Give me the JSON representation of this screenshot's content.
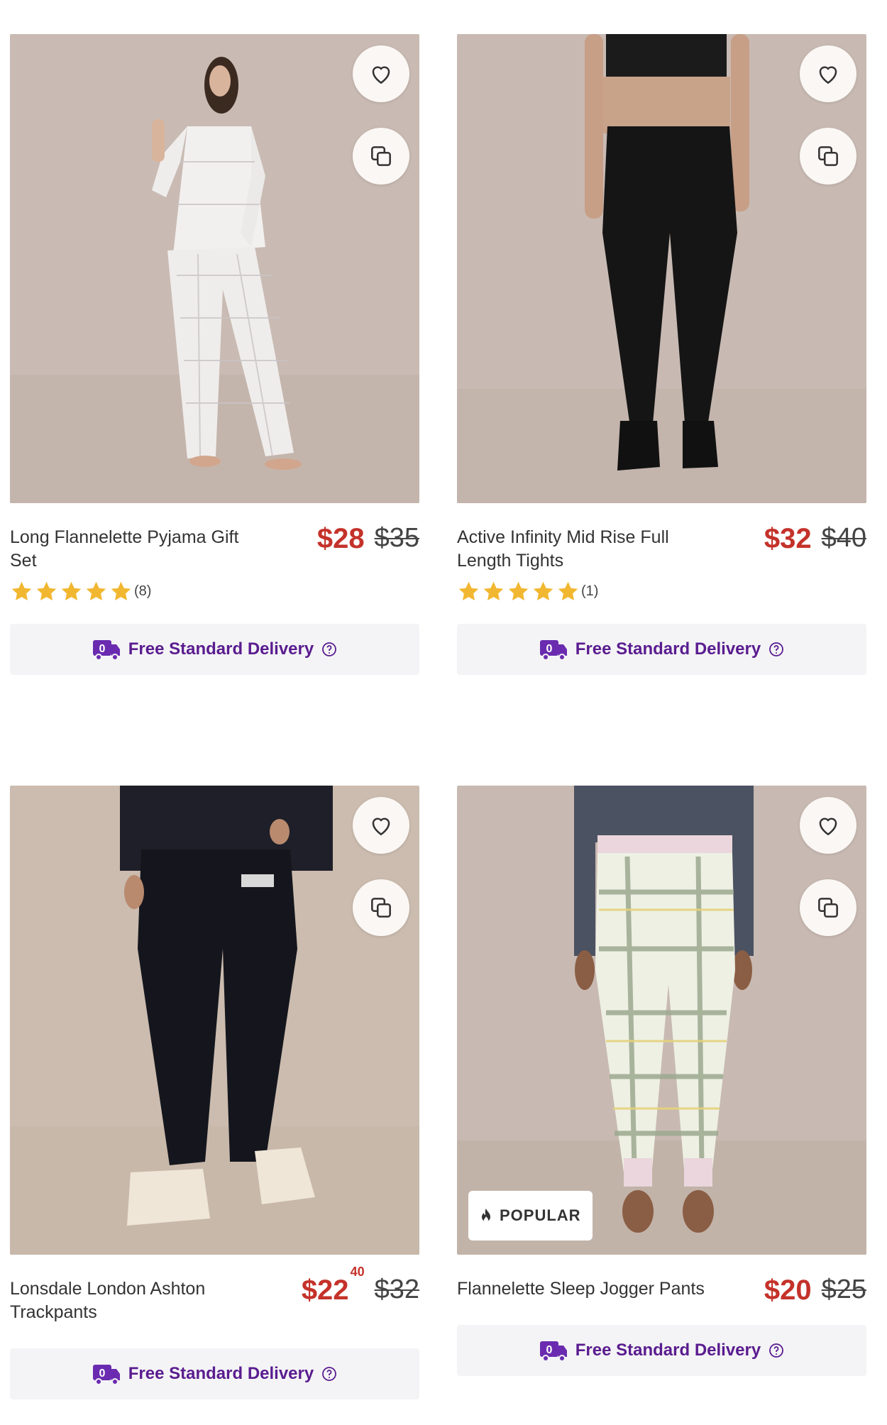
{
  "products": [
    {
      "name": "Long Flannelette Pyjama Gift Set",
      "price_now": "$28",
      "price_now_cents": "",
      "price_was": "$35",
      "rating": 5,
      "review_count": "(8)",
      "delivery_label": "Free Standard Delivery",
      "badge": ""
    },
    {
      "name": "Active Infinity Mid Rise Full Length Tights",
      "price_now": "$32",
      "price_now_cents": "",
      "price_was": "$40",
      "rating": 5,
      "review_count": "(1)",
      "delivery_label": "Free Standard Delivery",
      "badge": ""
    },
    {
      "name": "Lonsdale London Ashton Trackpants",
      "price_now": "$22",
      "price_now_cents": "40",
      "price_was": "$32",
      "rating": null,
      "review_count": "",
      "delivery_label": "Free Standard Delivery",
      "badge": ""
    },
    {
      "name": "Flannelette Sleep Jogger Pants",
      "price_now": "$20",
      "price_now_cents": "",
      "price_was": "$25",
      "rating": null,
      "review_count": "",
      "delivery_label": "Free Standard Delivery",
      "badge": "POPULAR"
    }
  ],
  "icons": {
    "wishlist": "heart-icon",
    "compare": "compare-icon",
    "delivery": "delivery-truck-icon",
    "help": "help-circle-icon",
    "popular": "flame-icon",
    "rating": "star-icon"
  },
  "colors": {
    "price_sale": "#c4322a",
    "delivery_text": "#5a1c8f",
    "star": "#f2b731",
    "delivery_bg": "#f4f4f6"
  }
}
